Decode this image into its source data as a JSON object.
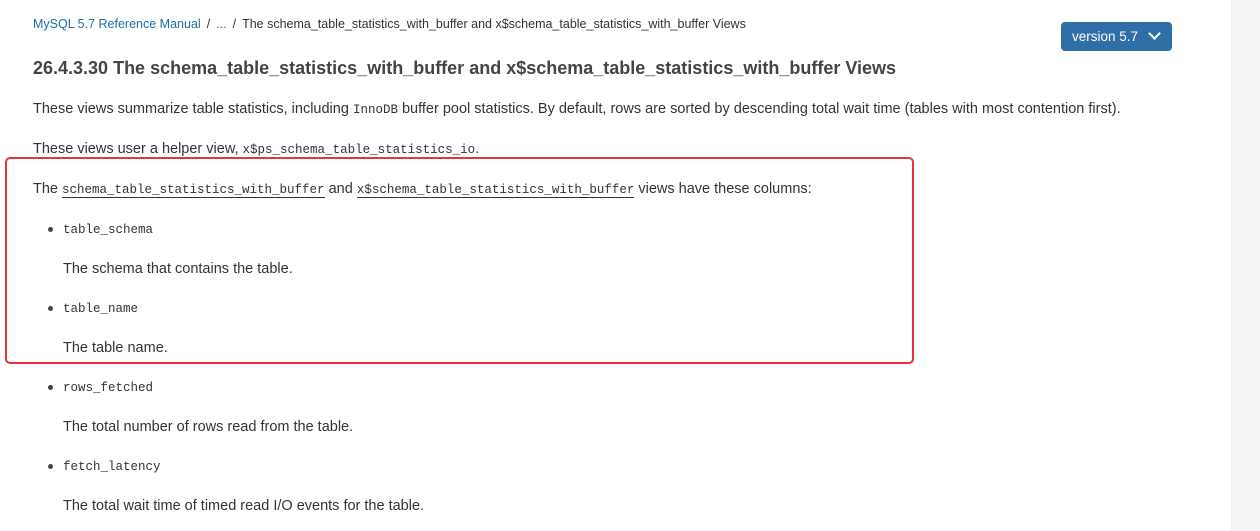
{
  "breadcrumb": {
    "manual": "MySQL 5.7 Reference Manual",
    "separator": "/",
    "ellipsis": "...",
    "current": "The schema_table_statistics_with_buffer and x$schema_table_statistics_with_buffer Views"
  },
  "version_button": {
    "label": "version 5.7",
    "icon": "chevron-down-icon"
  },
  "title": "26.4.3.30 The schema_table_statistics_with_buffer and x$schema_table_statistics_with_buffer Views",
  "para1": {
    "before": "These views summarize table statistics, including ",
    "code": "InnoDB",
    "after": " buffer pool statistics. By default, rows are sorted by descending total wait time (tables with most contention first)."
  },
  "para2": {
    "before": "These views user a helper view, ",
    "code": "x$ps_schema_table_statistics_io",
    "after": "."
  },
  "para3": {
    "before": "The ",
    "link1": "schema_table_statistics_with_buffer",
    "mid": " and ",
    "link2": "x$schema_table_statistics_with_buffer",
    "after": " views have these columns:"
  },
  "columns": [
    {
      "name": "table_schema",
      "description": "The schema that contains the table."
    },
    {
      "name": "table_name",
      "description": "The table name."
    },
    {
      "name": "rows_fetched",
      "description": "The total number of rows read from the table."
    },
    {
      "name": "fetch_latency",
      "description": "The total wait time of timed read I/O events for the table."
    }
  ],
  "colors": {
    "link": "#1a6fa7",
    "version_button_bg": "#2f6fa6",
    "highlight_border": "#e8323f"
  }
}
